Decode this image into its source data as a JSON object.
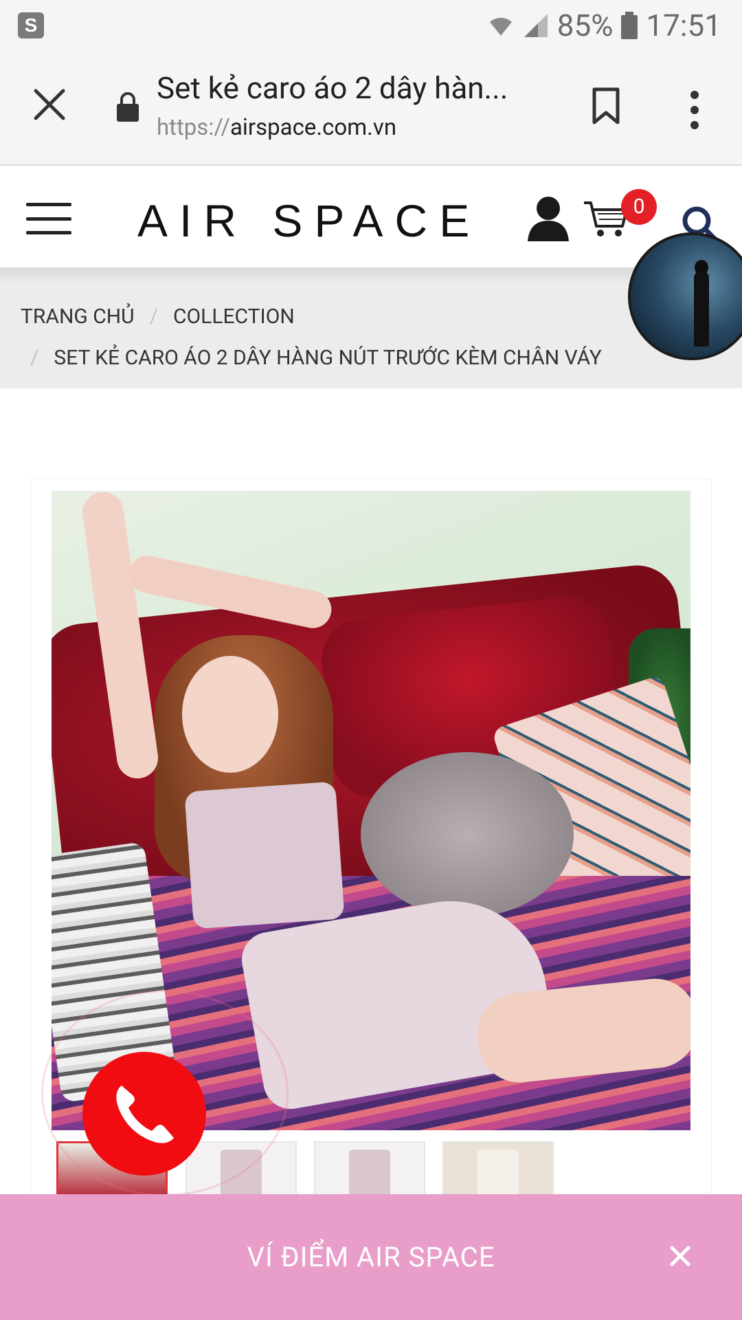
{
  "status_bar": {
    "app_icon": "S",
    "battery": "85%",
    "time": "17:51"
  },
  "browser": {
    "page_title": "Set kẻ caro áo 2 dây hàn...",
    "url_scheme": "https://",
    "url_host": "airspace.com.vn"
  },
  "site": {
    "logo": "AIR SPACE",
    "cart_count": "0"
  },
  "breadcrumb": {
    "items": [
      "TRANG CHỦ",
      "COLLECTION",
      "SET KẺ CARO ÁO 2 DÂY HÀNG NÚT TRƯỚC KÈM CHÂN VÁY"
    ],
    "separator": "/"
  },
  "banner": {
    "title": "VÍ ĐIỂM AIR SPACE",
    "close": "×"
  },
  "colors": {
    "accent_red": "#f10c12",
    "badge_red": "#e42026",
    "banner_pink": "#e89ec9"
  }
}
